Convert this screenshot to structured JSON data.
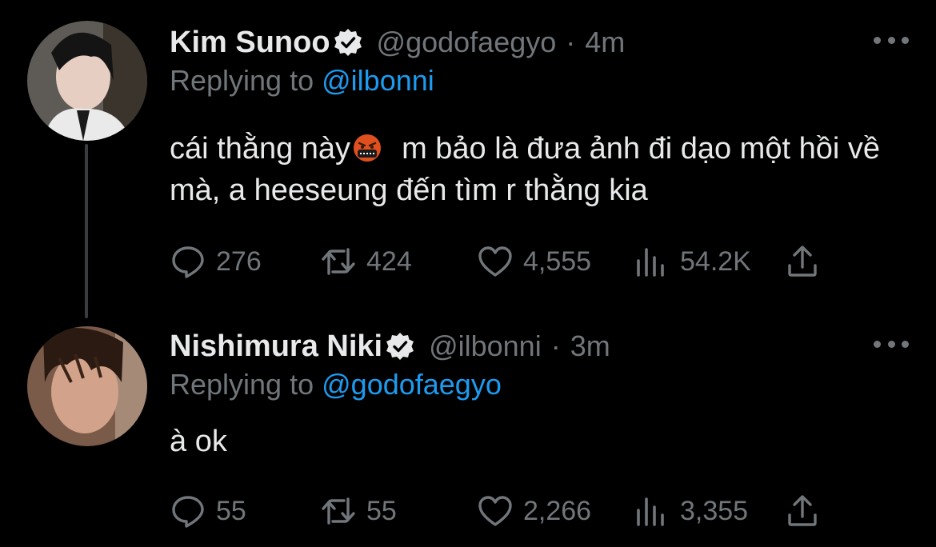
{
  "tweets": [
    {
      "name": "Kim Sunoo",
      "handle": "@godofaegyo",
      "separator": "·",
      "time": "4m",
      "replying_prefix": "Replying to",
      "replying_to": "@ilbonni",
      "text_before_emoji": "cái thằng này",
      "emoji": "face-with-symbols-on-mouth",
      "text_after_emoji": "m bảo là đưa ảnh đi dạo một hồi về mà, a heeseung đến tìm r thằng kia",
      "stats": {
        "replies": "276",
        "retweets": "424",
        "likes": "4,555",
        "views": "54.2K"
      }
    },
    {
      "name": "Nishimura Niki",
      "handle": "@ilbonni",
      "separator": "·",
      "time": "3m",
      "replying_prefix": "Replying to",
      "replying_to": "@godofaegyo",
      "text": "à ok",
      "stats": {
        "replies": "55",
        "retweets": "55",
        "likes": "2,266",
        "views": "3,355"
      }
    }
  ],
  "icons": {
    "reply": "reply-icon",
    "retweet": "retweet-icon",
    "like": "heart-icon",
    "views": "views-icon",
    "share": "share-icon",
    "more": "more-icon",
    "verified": "verified-badge-icon"
  },
  "colors": {
    "background": "#000000",
    "text_primary": "#e7e9ea",
    "text_secondary": "#71767b",
    "accent": "#1d9bf0"
  }
}
